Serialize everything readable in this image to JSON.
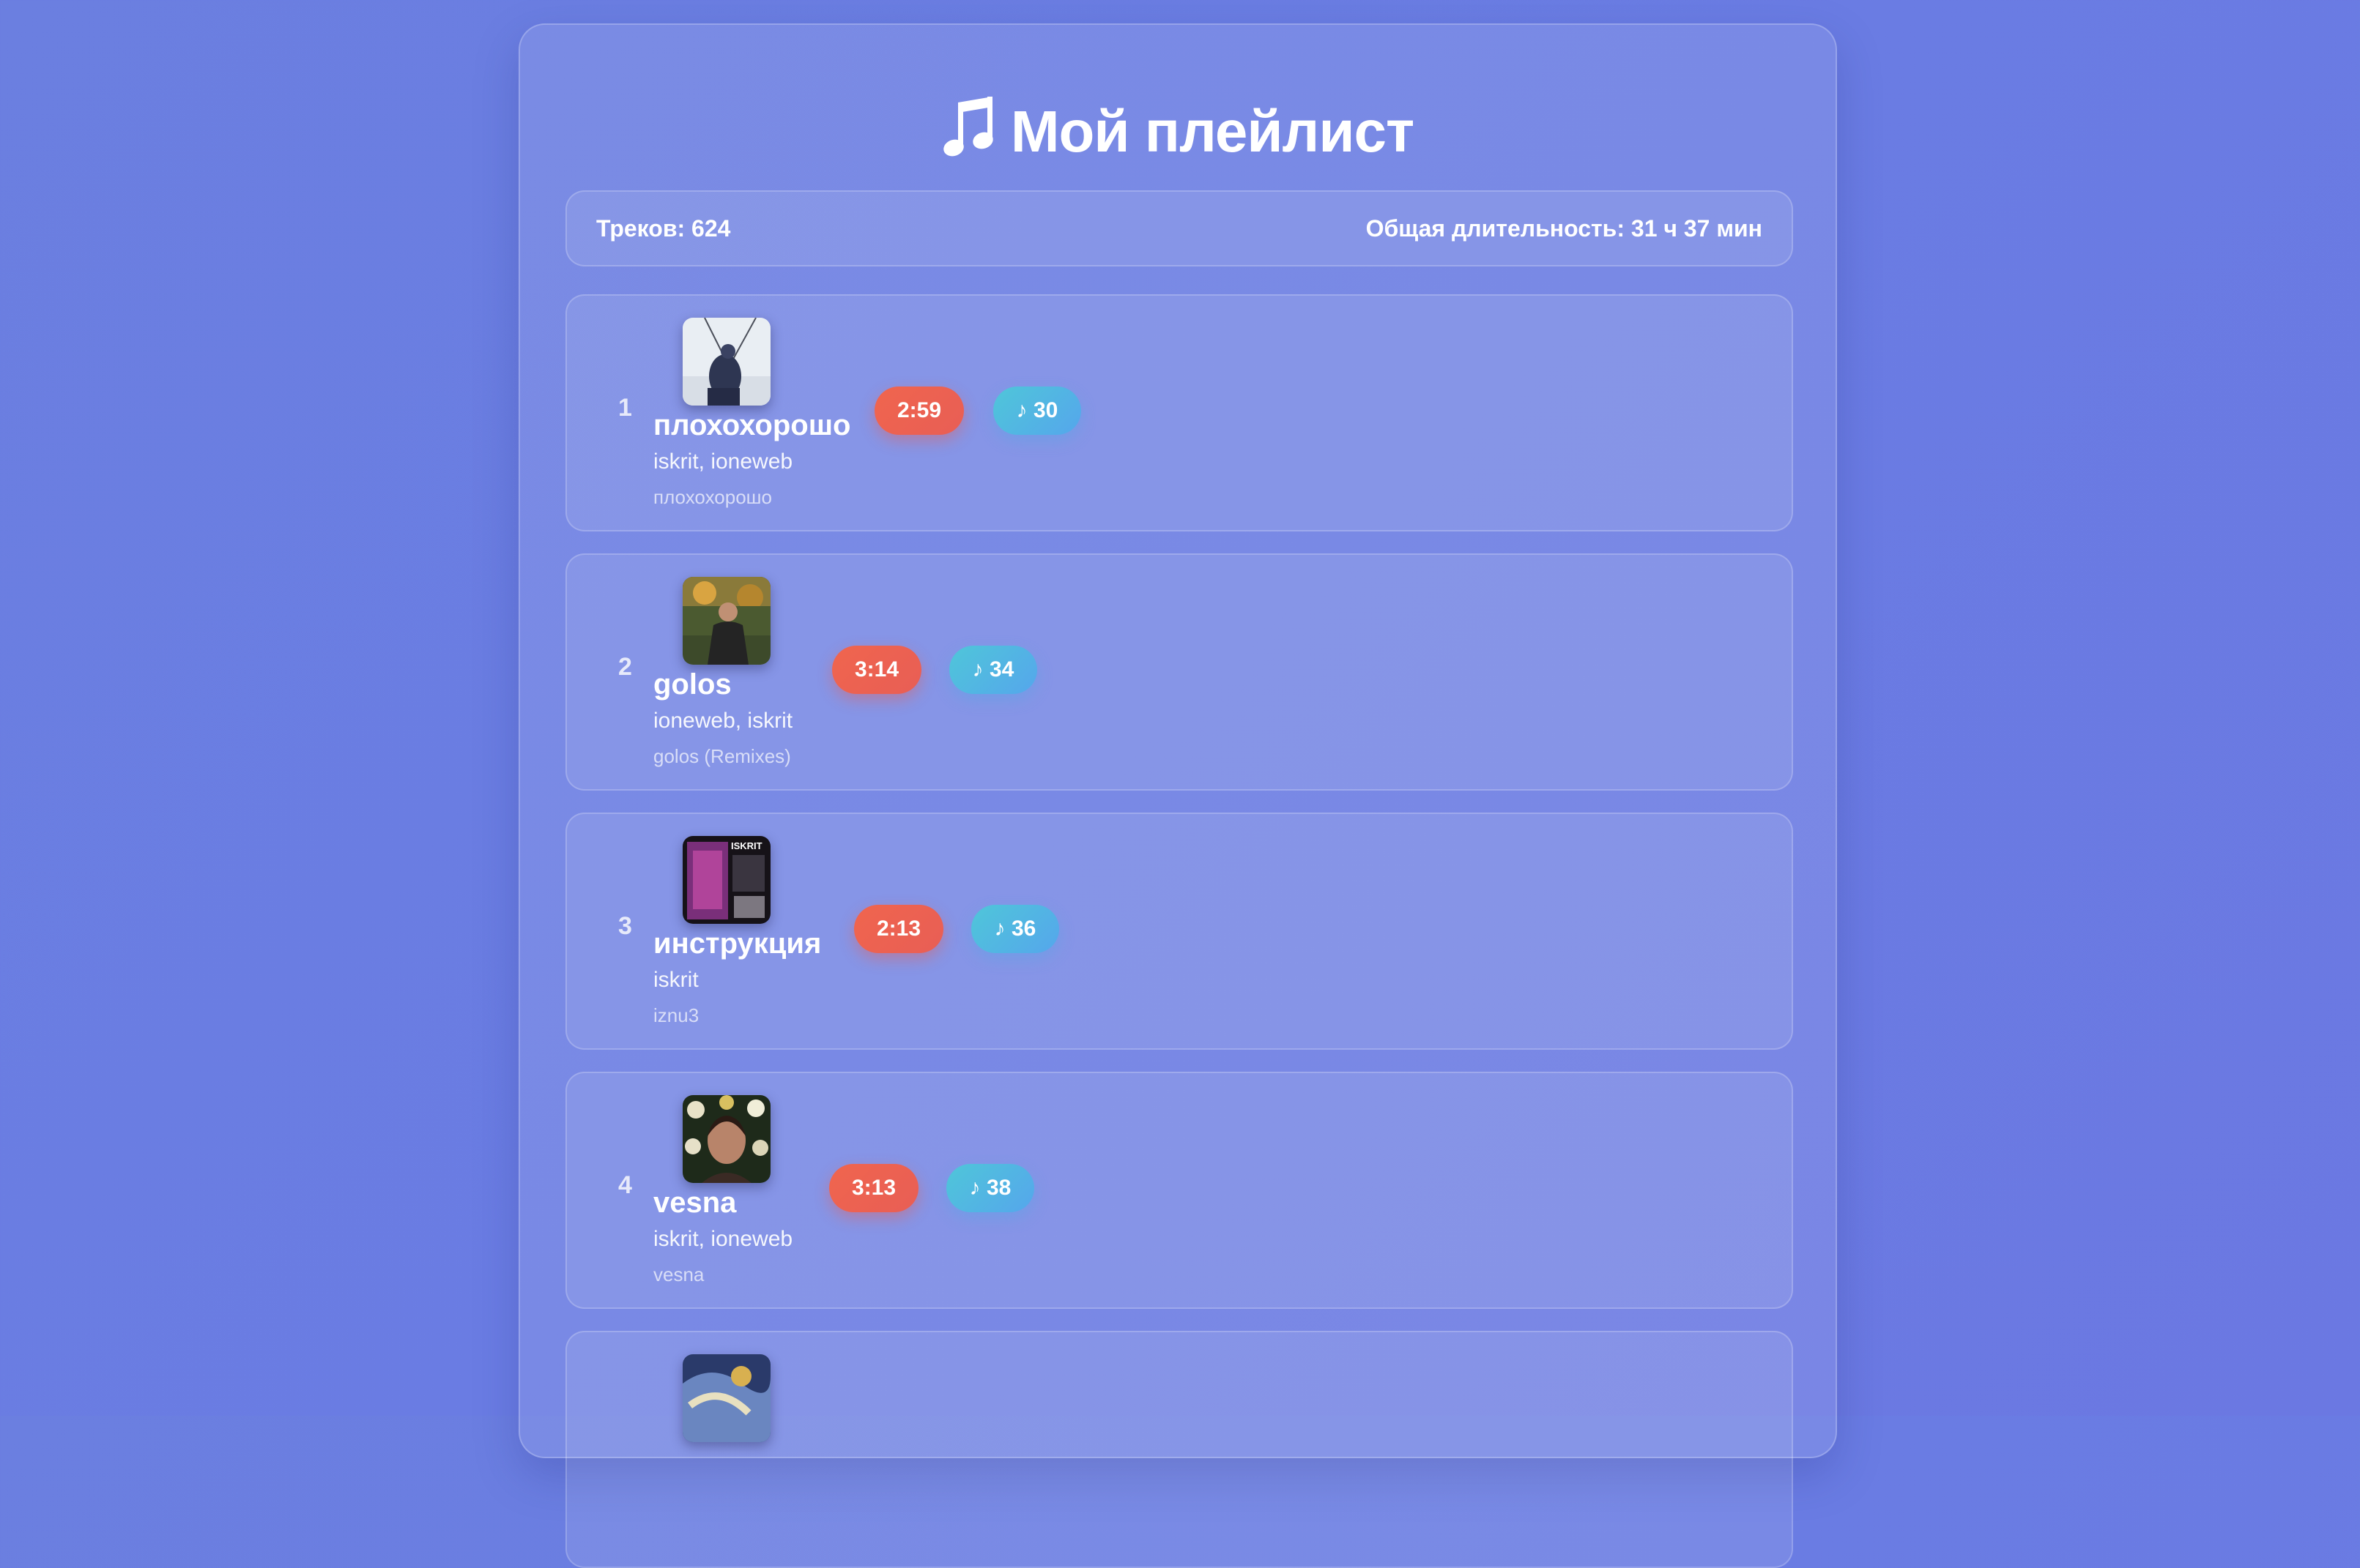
{
  "header": {
    "icon": "music-note-icon",
    "title": "Мой плейлист"
  },
  "stats": {
    "tracks_label": "Треков: 624",
    "duration_label": "Общая длительность: 31 ч 37 мин"
  },
  "tracks": [
    {
      "number": "1",
      "title": "плохохорошо",
      "artists": "iskrit, ioneweb",
      "album": "плохохорошо",
      "duration": "2:59",
      "count": "♪ 30",
      "cover": "album-cover-1"
    },
    {
      "number": "2",
      "title": "golos",
      "artists": "ioneweb, iskrit",
      "album": "golos (Remixes)",
      "duration": "3:14",
      "count": "♪ 34",
      "cover": "album-cover-2"
    },
    {
      "number": "3",
      "title": "инструкция",
      "artists": "iskrit",
      "album": "iznu3",
      "duration": "2:13",
      "count": "♪ 36",
      "cover": "album-cover-3",
      "cover_text": "ISKRIT"
    },
    {
      "number": "4",
      "title": "vesna",
      "artists": "iskrit, ioneweb",
      "album": "vesna",
      "duration": "3:13",
      "count": "♪ 38",
      "cover": "album-cover-4"
    },
    {
      "cover": "album-cover-5"
    }
  ],
  "colors": {
    "background": "#6b7fe0",
    "duration_badge": "#ee6250",
    "count_badge": "#52b6e4"
  }
}
